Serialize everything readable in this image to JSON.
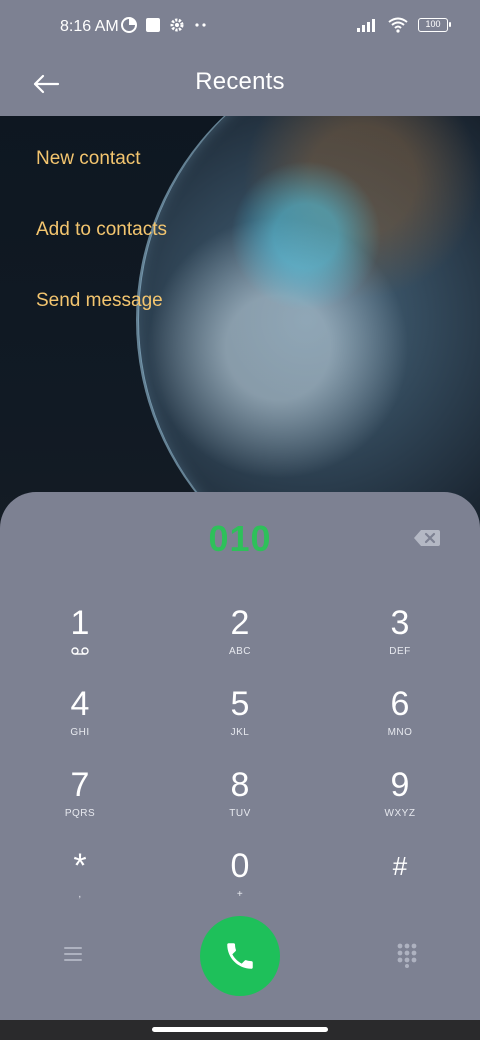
{
  "status_bar": {
    "time": "8:16 AM",
    "battery": "100",
    "icons": [
      "data-saver-icon",
      "square-notification-icon",
      "gear-icon",
      "more-dots-icon",
      "signal-icon",
      "wifi-icon",
      "battery-icon"
    ]
  },
  "header": {
    "title": "Recents",
    "back_icon": "back-arrow-icon"
  },
  "actions": [
    {
      "label": "New contact"
    },
    {
      "label": "Add to contacts"
    },
    {
      "label": "Send message"
    }
  ],
  "dialer": {
    "number": "010",
    "keys": [
      {
        "digit": "1",
        "sub": ""
      },
      {
        "digit": "2",
        "sub": "ABC"
      },
      {
        "digit": "3",
        "sub": "DEF"
      },
      {
        "digit": "4",
        "sub": "GHI"
      },
      {
        "digit": "5",
        "sub": "JKL"
      },
      {
        "digit": "6",
        "sub": "MNO"
      },
      {
        "digit": "7",
        "sub": "PQRS"
      },
      {
        "digit": "8",
        "sub": "TUV"
      },
      {
        "digit": "9",
        "sub": "WXYZ"
      },
      {
        "digit": "*",
        "sub": ","
      },
      {
        "digit": "0",
        "sub": "+"
      },
      {
        "digit": "#",
        "sub": ""
      }
    ]
  },
  "colors": {
    "action_text": "#f3c56f",
    "number_text": "#2ec05a",
    "call_button": "#1ec05a",
    "panel": "#7d8192"
  }
}
